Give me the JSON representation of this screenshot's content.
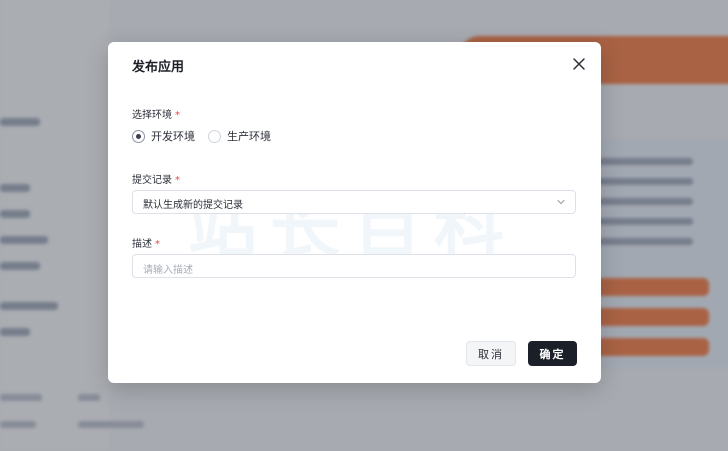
{
  "dialog": {
    "title": "发布应用",
    "environment": {
      "label": "选择环境",
      "required_mark": "*",
      "options": [
        {
          "label": "开发环境",
          "selected": true
        },
        {
          "label": "生产环境",
          "selected": false
        }
      ]
    },
    "commit": {
      "label": "提交记录",
      "required_mark": "*",
      "selected_value": "默认生成新的提交记录"
    },
    "description": {
      "label": "描述",
      "required_mark": "*",
      "placeholder": "请输入描述",
      "value": ""
    },
    "cancel_label": "取消",
    "confirm_label": "确定"
  },
  "icons": {
    "close": "close-icon",
    "dropdown": "chevron-down-icon"
  },
  "watermark": "站长百科",
  "colors": {
    "primary_button": "#1b1f27",
    "required": "#e5484d",
    "background_accent": "#f2743a"
  }
}
